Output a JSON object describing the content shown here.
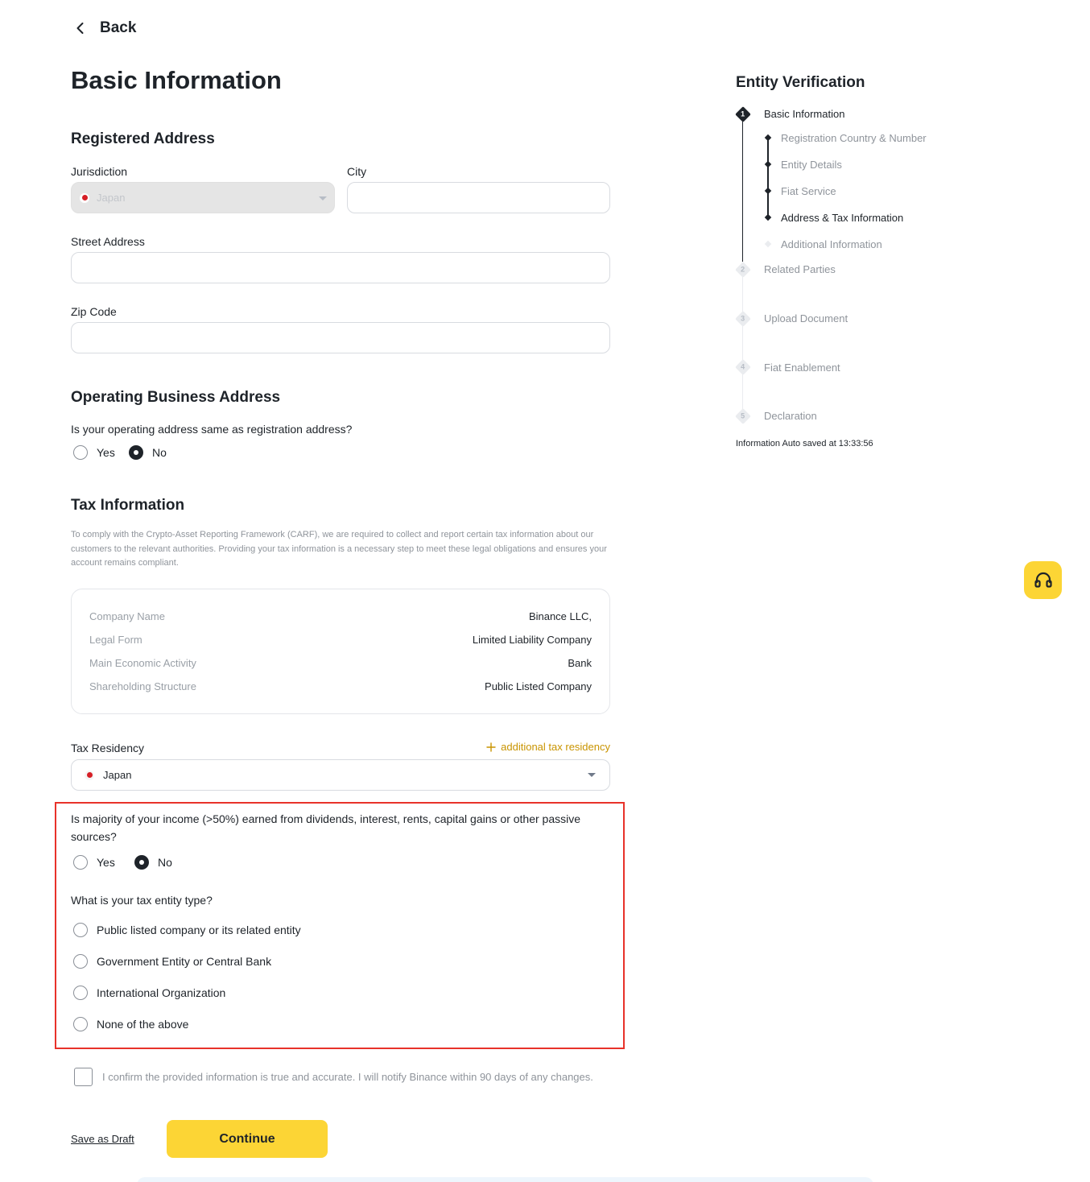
{
  "nav": {
    "back_label": "Back"
  },
  "page": {
    "title": "Basic Information"
  },
  "registered_address": {
    "title": "Registered Address",
    "jurisdiction_label": "Jurisdiction",
    "jurisdiction_value": "Japan",
    "city_label": "City",
    "city_value": "",
    "street_label": "Street Address",
    "street_value": "",
    "zip_label": "Zip Code",
    "zip_value": ""
  },
  "operating_address": {
    "title": "Operating Business Address",
    "question": "Is your operating address same as registration address?",
    "options": [
      "Yes",
      "No"
    ],
    "selected": "No"
  },
  "tax": {
    "title": "Tax Information",
    "description": "To comply with the Crypto-Asset Reporting Framework (CARF), we are required to collect and report certain tax information about our customers to the relevant authorities. Providing your tax information is a necessary step to meet these legal obligations and ensures your account remains compliant.",
    "company_info": [
      {
        "key": "Company Name",
        "value": "Binance LLC,"
      },
      {
        "key": "Legal Form",
        "value": "Limited Liability Company"
      },
      {
        "key": "Main Economic Activity",
        "value": "Bank"
      },
      {
        "key": "Shareholding Structure",
        "value": "Public Listed Company"
      }
    ],
    "residency_label": "Tax Residency",
    "add_residency_label": "additional tax residency",
    "residency_value": "Japan",
    "passive_income_question": "Is majority of your income (>50%) earned from dividends, interest, rents, capital gains or other passive sources?",
    "passive_income_options": [
      "Yes",
      "No"
    ],
    "passive_income_selected": "No",
    "entity_type_question": "What is your tax entity type?",
    "entity_type_options": [
      "Public listed company or its related entity",
      "Government Entity or Central Bank",
      "International Organization",
      "None of the above"
    ],
    "entity_type_selected": null
  },
  "confirm": {
    "text": "I confirm the provided information is true and accurate. I will notify Binance within 90 days of any changes.",
    "checked": false
  },
  "actions": {
    "save_draft": "Save as Draft",
    "continue": "Continue"
  },
  "sidebar": {
    "title": "Entity Verification",
    "steps": [
      {
        "number": "1",
        "label": "Basic Information",
        "active": true
      },
      {
        "number": "2",
        "label": "Related Parties",
        "active": false
      },
      {
        "number": "3",
        "label": "Upload Document",
        "active": false
      },
      {
        "number": "4",
        "label": "Fiat Enablement",
        "active": false
      },
      {
        "number": "5",
        "label": "Declaration",
        "active": false
      }
    ],
    "substeps": [
      {
        "label": "Registration Country & Number",
        "state": "done"
      },
      {
        "label": "Entity Details",
        "state": "done"
      },
      {
        "label": "Fiat Service",
        "state": "done"
      },
      {
        "label": "Address  & Tax Information",
        "state": "current"
      },
      {
        "label": "Additional Information",
        "state": "todo"
      }
    ],
    "autosave": "Information Auto saved at 13:33:56"
  },
  "colors": {
    "accent": "#fcd535",
    "link_accent": "#c99400",
    "highlight_border": "#e8322a",
    "text": "#1e2329",
    "muted": "#8f949b"
  },
  "icons": {
    "back": "chevron-left-icon",
    "support": "headset-icon",
    "plus": "plus-icon",
    "flag": "japan-flag-icon"
  }
}
